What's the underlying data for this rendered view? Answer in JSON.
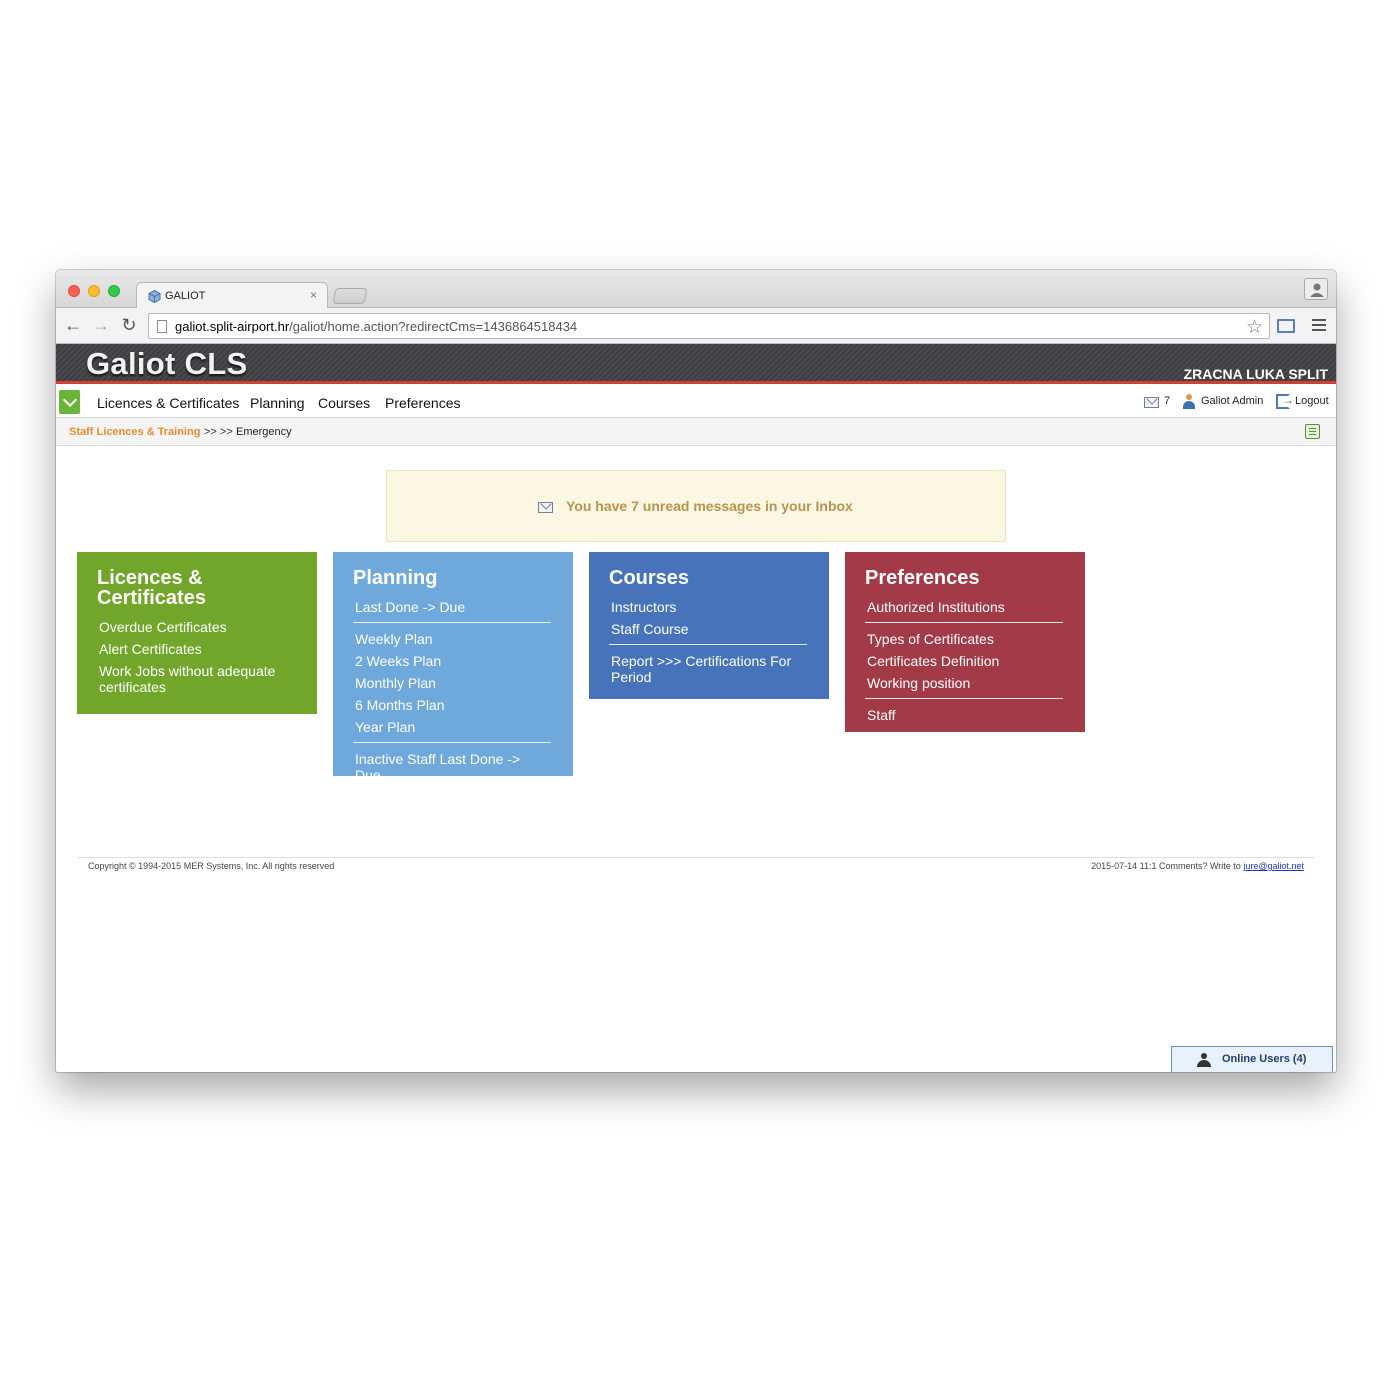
{
  "browser": {
    "tab_title": "GALIOT",
    "tab_close": "×",
    "url_host": "galiot.split-airport.hr",
    "url_path": "/galiot/home.action?redirectCms=1436864518434"
  },
  "header": {
    "logo": "Galiot CLS",
    "organization": "ZRACNA LUKA SPLIT"
  },
  "menu": {
    "items": [
      "Licences & Certificates",
      "Planning",
      "Courses",
      "Preferences"
    ],
    "messages_count": "7",
    "user_name": "Galiot Admin",
    "logout_label": "Logout"
  },
  "breadcrumb": {
    "home": "Staff Licences & Training",
    "separator": ">> >>",
    "current": "Emergency"
  },
  "message": {
    "text": "You have 7 unread messages in your Inbox"
  },
  "tiles": [
    {
      "title": "Licences & Certificates",
      "color": "#72a62a",
      "links": [
        "Overdue Certificates",
        "Alert Certificates",
        "Work Jobs without adequate certificates"
      ]
    },
    {
      "title": "Planning",
      "color": "#6fa8da",
      "links": [
        "Last Done -> Due",
        "Weekly Plan",
        "2 Weeks Plan",
        "Monthly Plan",
        "6 Months Plan",
        "Year Plan",
        "Inactive Staff Last Done -> Due"
      ]
    },
    {
      "title": "Courses",
      "color": "#4673b9",
      "links": [
        "Instructors",
        "Staff Course",
        "Report >>> Certifications For Period"
      ]
    },
    {
      "title": "Preferences",
      "color": "#a23a47",
      "links": [
        "Authorized Institutions",
        "Types of Certificates",
        "Certificates Definition",
        "Working position",
        "Staff"
      ]
    }
  ],
  "footer": {
    "copyright": "Copyright © 1994-2015 MER Systems, Inc. All rights reserved",
    "right_text": "2015-07-14 11:1 Comments? Write to",
    "email": "jure@galiot.net"
  },
  "online_users": {
    "label": "Online Users (4)"
  },
  "colors": {
    "header_accent": "#d2402f",
    "breadcrumb_home": "#e88c2e",
    "message_text": "#b89352"
  }
}
